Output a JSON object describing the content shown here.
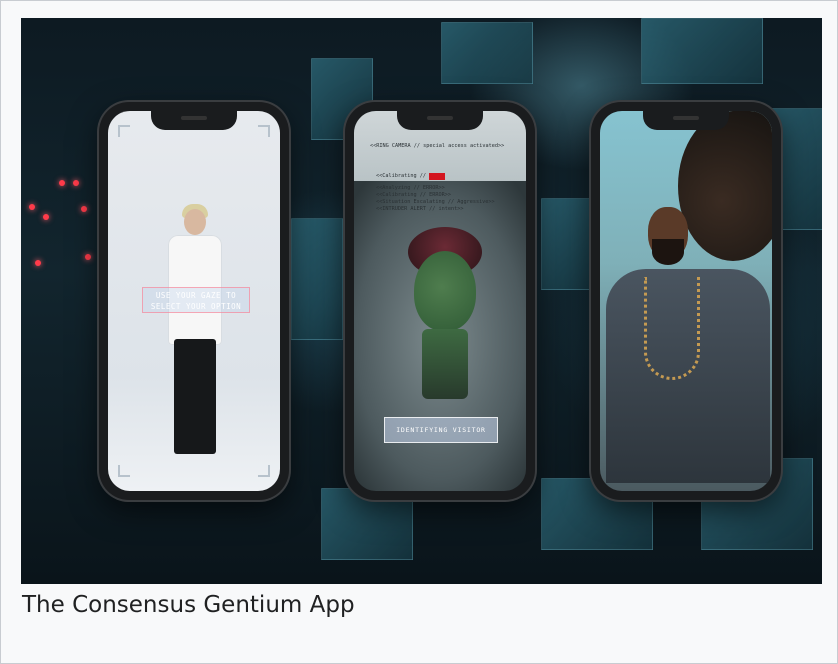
{
  "caption": "The Consensus Gentium App",
  "phones": [
    {
      "name": "phone-gaze-select",
      "hud_text": "USE YOUR GAZE TO SELECT YOUR OPTION"
    },
    {
      "name": "phone-ring-camera",
      "header_text": "<<RING CAMERA // special access activated>>",
      "log_lines": [
        "<<Calibrating // ",
        "<<Analyzing // ERROR>>",
        "<<Calibrating // ERROR>>",
        "<<Situation Escalating // Aggressive>>",
        "<<INTRUDER ALERT // intent>>"
      ],
      "button_text": "IDENTIFYING VISITOR"
    },
    {
      "name": "phone-portrait"
    }
  ],
  "colors": {
    "alert_red": "#d3151f",
    "caption_text": "#202122",
    "frame_bg": "#f8f9fa"
  }
}
